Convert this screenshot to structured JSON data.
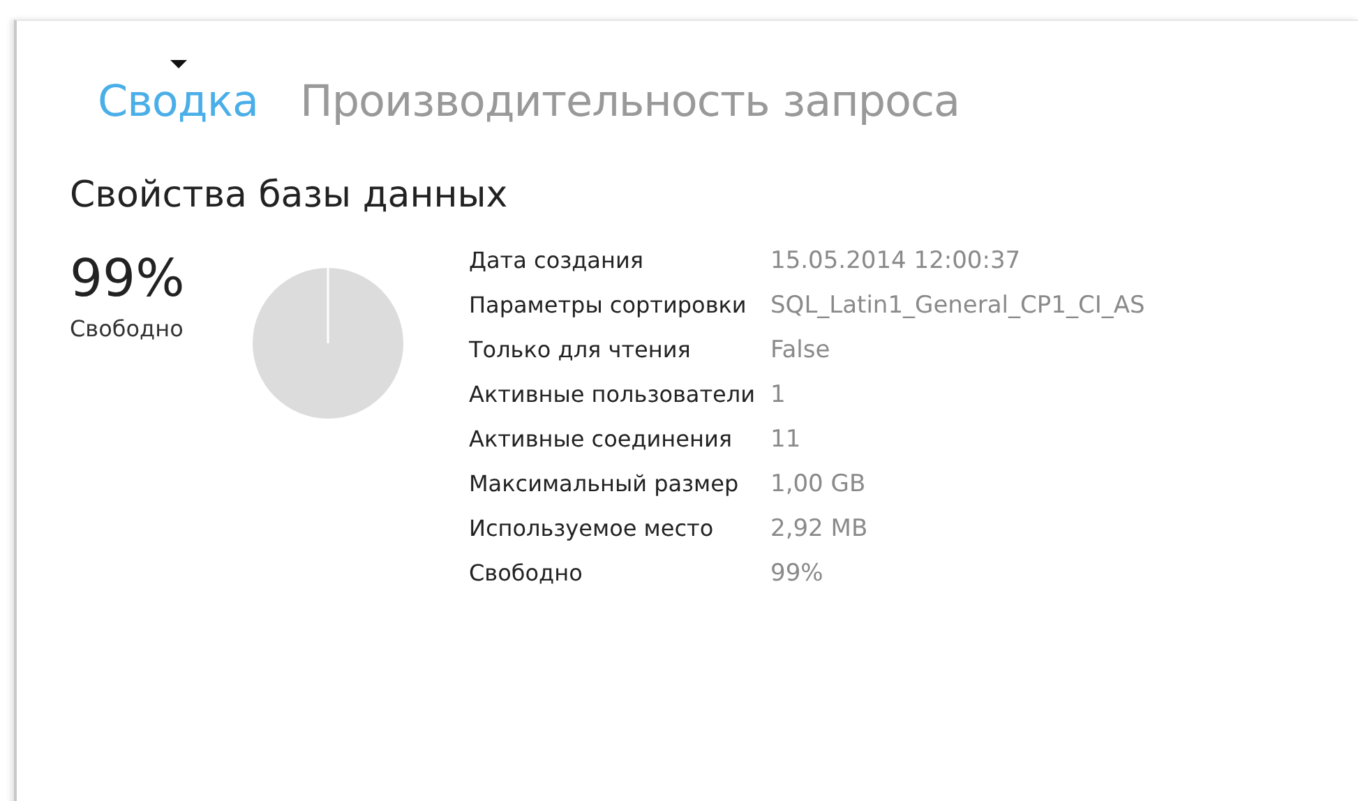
{
  "tabs": [
    {
      "label": "Сводка",
      "selected": true
    },
    {
      "label": "Производительность запроса",
      "selected": false
    }
  ],
  "section_title": "Свойства базы данных",
  "summary": {
    "value": "99%",
    "label": "Свободно"
  },
  "properties": [
    {
      "name": "Дата создания",
      "value": "15.05.2014 12:00:37"
    },
    {
      "name": "Параметры сортировки",
      "value": "SQL_Latin1_General_CP1_CI_AS"
    },
    {
      "name": "Только для чтения",
      "value": "False"
    },
    {
      "name": "Активные пользователи",
      "value": "1"
    },
    {
      "name": "Активные соединения",
      "value": "11"
    },
    {
      "name": "Максимальный размер",
      "value": "1,00 GB"
    },
    {
      "name": "Используемое место",
      "value": "2,92 MB"
    },
    {
      "name": "Свободно",
      "value": "99%"
    }
  ]
}
